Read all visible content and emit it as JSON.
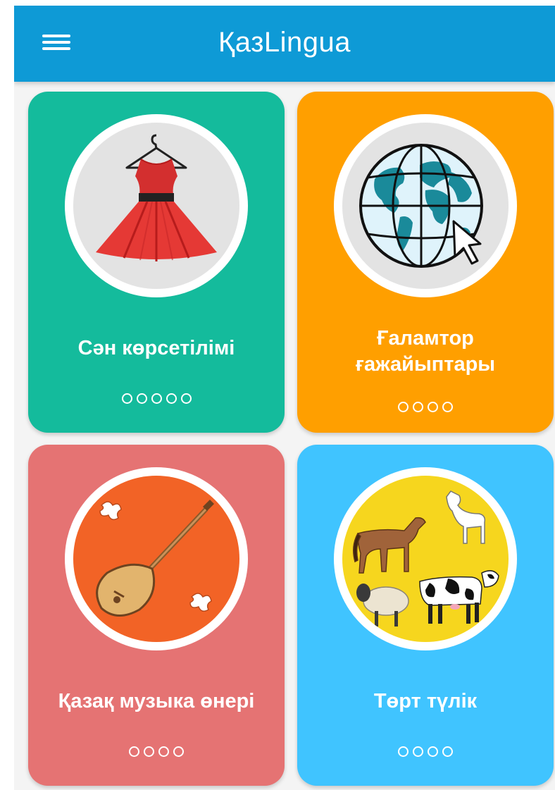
{
  "app": {
    "title": "ҚазLingua",
    "menu_icon": "hamburger-menu-icon",
    "header_color": "#0e9ad6"
  },
  "cards": [
    {
      "title": "Сән көрсетілімі",
      "color": "#14bb9c",
      "icon": "red-dress-icon",
      "pages": 5,
      "current_page": 0
    },
    {
      "title": "Ғаламтор ғажайыптары",
      "color": "#ff9f00",
      "icon": "globe-cursor-icon",
      "pages": 4,
      "current_page": 0
    },
    {
      "title": "Қазақ музыка өнері",
      "color": "#e57373",
      "icon": "dombra-icon",
      "pages": 4,
      "current_page": 0
    },
    {
      "title": "Төрт түлік",
      "color": "#40c4ff",
      "icon": "livestock-animals-icon",
      "pages": 4,
      "current_page": 0
    }
  ]
}
